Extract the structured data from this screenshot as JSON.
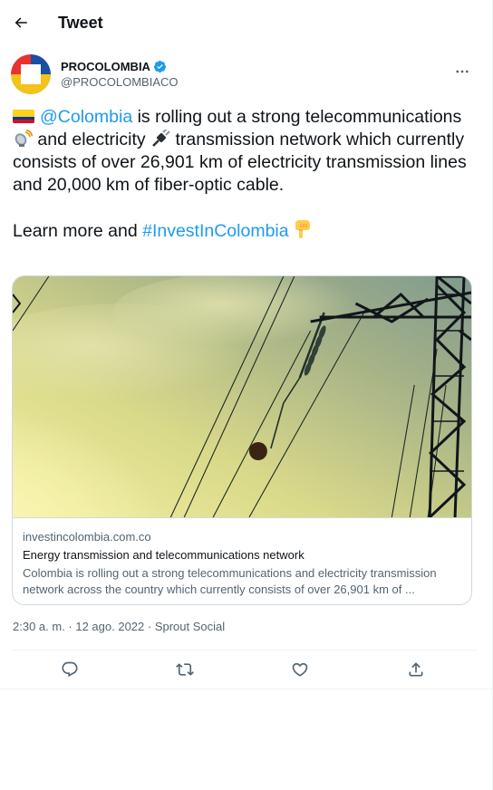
{
  "header": {
    "title": "Tweet"
  },
  "author": {
    "name": "PROCOLOMBIA",
    "handle": "@PROCOLOMBIACO"
  },
  "tweet": {
    "mention": "@Colombia",
    "text_1": " is rolling out a strong telecommunications ",
    "text_2": " and electricity ",
    "text_3": " transmission network which currently consists of over 26,901 km of electricity transmission lines and 20,000 km of fiber-optic cable.",
    "learn_prefix": "Learn more and ",
    "hashtag": "#InvestInColombia"
  },
  "card": {
    "domain": "investincolombia.com.co",
    "title": "Energy transmission and telecommunications network",
    "description": "Colombia is rolling out a strong telecommunications and electricity transmission network across the country which currently consists of over 26,901 km of ..."
  },
  "meta": {
    "text": "2:30 a. m. · 12 ago. 2022 · Sprout Social"
  },
  "icons": {
    "back": "arrow-left-icon",
    "verified": "verified-badge-icon",
    "more": "more-horizontal-icon",
    "reply": "reply-icon",
    "retweet": "retweet-icon",
    "like": "like-icon",
    "share": "share-icon"
  },
  "colors": {
    "link": "#1d9bf0",
    "text": "#0f1419",
    "secondary": "#536471",
    "border": "#cfd9de"
  }
}
